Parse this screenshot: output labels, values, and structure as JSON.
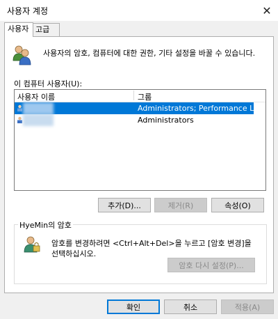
{
  "window": {
    "title": "사용자 계정",
    "close_glyph": "✕"
  },
  "tabs": [
    {
      "label": "사용자",
      "active": true
    },
    {
      "label": "고급",
      "active": false
    }
  ],
  "intro": {
    "icon": "users-icon",
    "text": "사용자의 암호, 컴퓨터에 대한 권한, 기타 설정을 바꿀 수 있습니다."
  },
  "users": {
    "label": "이 컴퓨터 사용자(U):",
    "columns": [
      "사용자 이름",
      "그룹"
    ],
    "rows": [
      {
        "name": "",
        "group": "Administrators; Performance Log ...",
        "selected": true
      },
      {
        "name": "",
        "group": "Administrators",
        "selected": false
      }
    ],
    "buttons": {
      "add": "추가(D)...",
      "remove": "제거(R)",
      "properties": "속성(O)"
    }
  },
  "password": {
    "title": "HyeMin의 암호",
    "text": "암호를 변경하려면 <Ctrl+Alt+Del>을 누르고 [암호 변경]을 선택하십시오.",
    "reset_label": "암호 다시 설정(P)..."
  },
  "footer": {
    "ok": "확인",
    "cancel": "취소",
    "apply": "적용(A)"
  },
  "colors": {
    "selection": "#0078d7",
    "default_button_border": "#0078d7"
  }
}
